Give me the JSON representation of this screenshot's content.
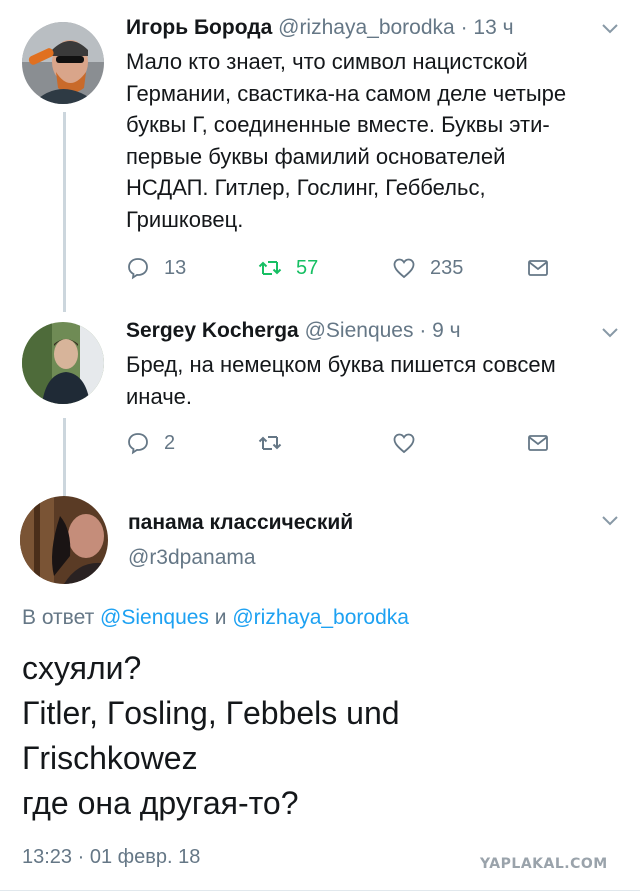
{
  "tweets": [
    {
      "name": "Игорь Борода",
      "handle": "@rizhaya_borodka",
      "sep": "·",
      "time": "13 ч",
      "text_lines": [
        "Мало кто знает, что символ нацистской",
        "Германии, свастика-на самом деле четыре",
        "буквы Г, соединенные вместе. Буквы эти-",
        "первые буквы фамилий основателей",
        "НСДАП. Гитлер, Гослинг, Геббельс,",
        "Гришковец."
      ],
      "replies": "13",
      "retweets": "57",
      "likes": "235"
    },
    {
      "name": "Sergey Kocherga",
      "handle": "@Sienques",
      "sep": "·",
      "time": "9 ч",
      "text_lines": [
        "Бред, на немецком буква пишется совсем",
        "иначе."
      ],
      "replies": "2",
      "retweets": "",
      "likes": ""
    }
  ],
  "focused": {
    "name": "панама классический",
    "handle": "@r3dpanama",
    "reply_prefix": "В ответ",
    "reply_user1": "@Sienques",
    "reply_and": "и",
    "reply_user2": "@rizhaya_borodka",
    "text_lines": [
      "схуяли?",
      "Гitler, Гosling, Гebbels und",
      "Гrischkowez",
      "где она другая-то?"
    ],
    "timestamp": "13:23 · 01 февр. 18"
  },
  "watermark": "YAPLAKAL.COM",
  "colors": {
    "text": "#14171a",
    "muted": "#657786",
    "link": "#1da1f2",
    "retweet_active": "#17bf63",
    "thread_line": "#ccd6dd"
  },
  "icons": [
    "reply-icon",
    "retweet-icon",
    "like-icon",
    "direct-message-icon",
    "chevron-down-icon"
  ]
}
